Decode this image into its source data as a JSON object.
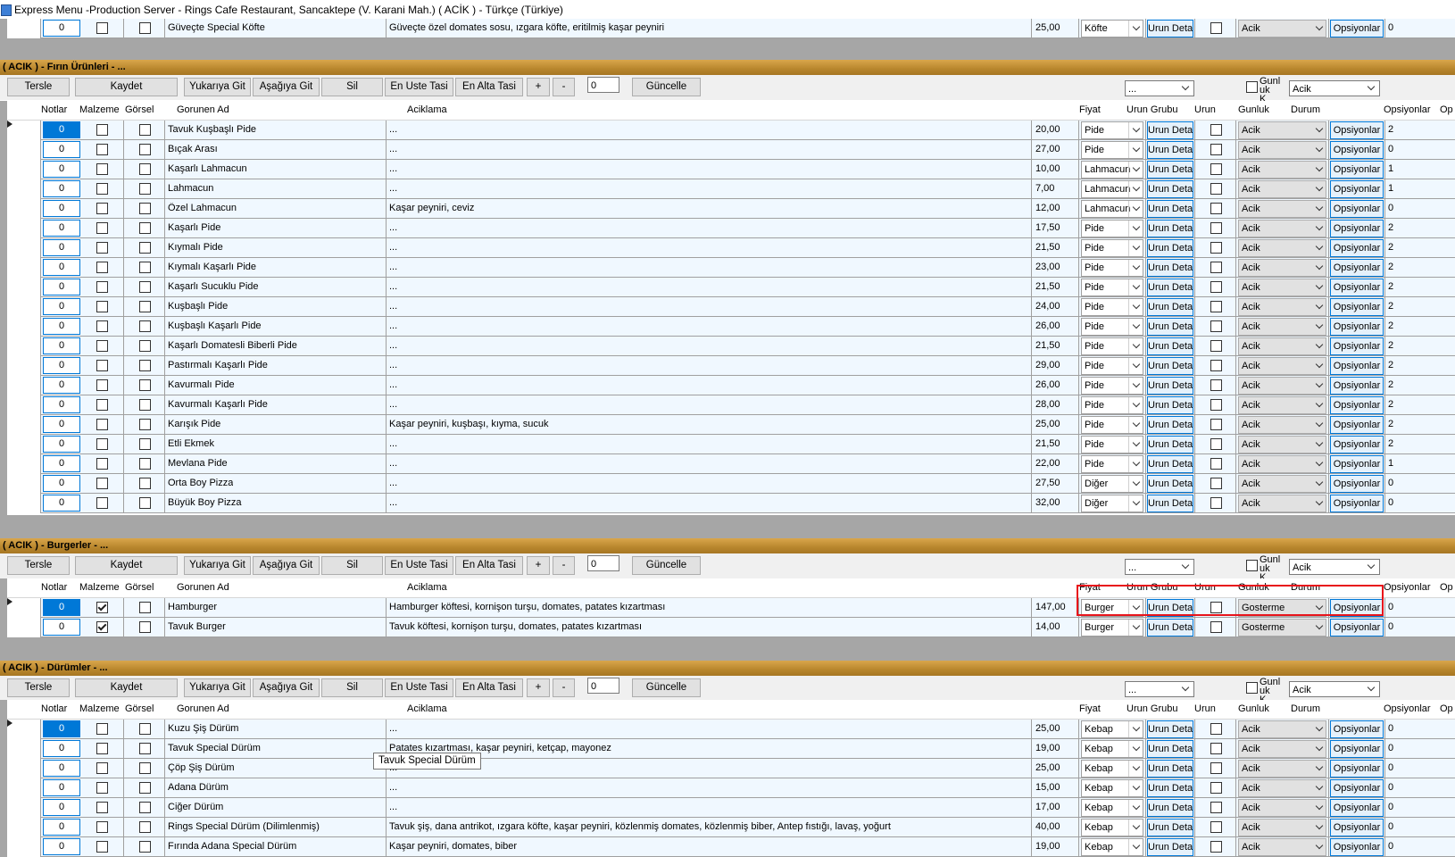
{
  "window": {
    "title": "Express Menu -Production Server - Rings Cafe Restaurant, Sancaktepe (V. Karani Mah.) ( ACİK ) - Türkçe (Türkiye)"
  },
  "columns": [
    "Notlar",
    "Malzeme",
    "Görsel",
    "Gorunen Ad",
    "Aciklama",
    "Fiyat",
    "Urun Grubu",
    "Urun",
    "Gunluk",
    "Durum",
    "Opsiyonlar",
    "Op"
  ],
  "toolbar": {
    "tersle": "Tersle",
    "kaydet": "Kaydet",
    "yukari": "Yukarıya Git",
    "asagi": "Aşağıya Git",
    "sil": "Sil",
    "en_uste": "En Uste Tasi",
    "en_alta": "En Alta Tasi",
    "plus": "+",
    "minus": "-",
    "order_value": "0",
    "guncelle": "Güncelle",
    "group_value": "...",
    "gunluk_label": "Gunl uk K",
    "durum_value": "Acik"
  },
  "common": {
    "detail_button": "Urun Detay",
    "options_button": "Opsiyonlar",
    "notes_value": "0"
  },
  "top_row": {
    "name": "Güveçte Special Köfte",
    "desc": "Güveçte özel domates sosu, ızgara köfte, eritilmiş kaşar peyniri",
    "price": "25,00",
    "group": "Köfte",
    "status": "Acik",
    "op": "0"
  },
  "sections": [
    {
      "title": "( ACIK ) - Fırın Ürünleri - ...",
      "rows": [
        {
          "name": "Tavuk Kuşbaşlı Pide",
          "desc": "...",
          "price": "20,00",
          "group": "Pide",
          "status": "Acik",
          "op": "2"
        },
        {
          "name": "Bıçak Arası",
          "desc": "...",
          "price": "27,00",
          "group": "Pide",
          "status": "Acik",
          "op": "0"
        },
        {
          "name": "Kaşarlı Lahmacun",
          "desc": "...",
          "price": "10,00",
          "group": "Lahmacun",
          "status": "Acik",
          "op": "1"
        },
        {
          "name": "Lahmacun",
          "desc": "...",
          "price": "7,00",
          "group": "Lahmacun",
          "status": "Acik",
          "op": "1"
        },
        {
          "name": "Özel Lahmacun",
          "desc": "Kaşar peyniri, ceviz",
          "price": "12,00",
          "group": "Lahmacun",
          "status": "Acik",
          "op": "0"
        },
        {
          "name": "Kaşarlı Pide",
          "desc": "...",
          "price": "17,50",
          "group": "Pide",
          "status": "Acik",
          "op": "2"
        },
        {
          "name": "Kıymalı Pide",
          "desc": "...",
          "price": "21,50",
          "group": "Pide",
          "status": "Acik",
          "op": "2"
        },
        {
          "name": "Kıymalı Kaşarlı Pide",
          "desc": "...",
          "price": "23,00",
          "group": "Pide",
          "status": "Acik",
          "op": "2"
        },
        {
          "name": "Kaşarlı Sucuklu Pide",
          "desc": "...",
          "price": "21,50",
          "group": "Pide",
          "status": "Acik",
          "op": "2"
        },
        {
          "name": "Kuşbaşlı Pide",
          "desc": "...",
          "price": "24,00",
          "group": "Pide",
          "status": "Acik",
          "op": "2"
        },
        {
          "name": "Kuşbaşlı Kaşarlı Pide",
          "desc": "...",
          "price": "26,00",
          "group": "Pide",
          "status": "Acik",
          "op": "2"
        },
        {
          "name": "Kaşarlı Domatesli Biberli Pide",
          "desc": "...",
          "price": "21,50",
          "group": "Pide",
          "status": "Acik",
          "op": "2"
        },
        {
          "name": "Pastırmalı Kaşarlı Pide",
          "desc": "...",
          "price": "29,00",
          "group": "Pide",
          "status": "Acik",
          "op": "2"
        },
        {
          "name": "Kavurmalı Pide",
          "desc": "...",
          "price": "26,00",
          "group": "Pide",
          "status": "Acik",
          "op": "2"
        },
        {
          "name": "Kavurmalı Kaşarlı Pide",
          "desc": "...",
          "price": "28,00",
          "group": "Pide",
          "status": "Acik",
          "op": "2"
        },
        {
          "name": "Karışık Pide",
          "desc": "Kaşar peyniri, kuşbaşı, kıyma, sucuk",
          "price": "25,00",
          "group": "Pide",
          "status": "Acik",
          "op": "2"
        },
        {
          "name": "Etli Ekmek",
          "desc": "...",
          "price": "21,50",
          "group": "Pide",
          "status": "Acik",
          "op": "2"
        },
        {
          "name": "Mevlana Pide",
          "desc": "...",
          "price": "22,00",
          "group": "Pide",
          "status": "Acik",
          "op": "1"
        },
        {
          "name": "Orta Boy Pizza",
          "desc": "...",
          "price": "27,50",
          "group": "Diğer",
          "status": "Acik",
          "op": "0"
        },
        {
          "name": "Büyük Boy Pizza",
          "desc": "...",
          "price": "32,00",
          "group": "Diğer",
          "status": "Acik",
          "op": "0"
        }
      ]
    },
    {
      "title": "( ACIK ) - Burgerler - ...",
      "rows": [
        {
          "name": "Hamburger",
          "desc": "Hamburger köftesi, kornişon turşu, domates, patates kızartması",
          "price": "147,00",
          "group": "Burger",
          "status": "Gosterme",
          "op": "0",
          "malzeme": true
        },
        {
          "name": "Tavuk Burger",
          "desc": "Tavuk köftesi, kornişon turşu, domates, patates kızartması",
          "price": "14,00",
          "group": "Burger",
          "status": "Gosterme",
          "op": "0",
          "malzeme": true
        }
      ]
    },
    {
      "title": "( ACIK ) - Dürümler - ...",
      "rows": [
        {
          "name": "Kuzu Şiş Dürüm",
          "desc": "...",
          "price": "25,00",
          "group": "Kebap",
          "status": "Acik",
          "op": "0"
        },
        {
          "name": "Tavuk Special Dürüm",
          "desc": "Patates kızartması, kaşar peyniri, ketçap, mayonez",
          "price": "19,00",
          "group": "Kebap",
          "status": "Acik",
          "op": "0"
        },
        {
          "name": "Çöp Şiş Dürüm",
          "desc": "...",
          "price": "25,00",
          "group": "Kebap",
          "status": "Acik",
          "op": "0"
        },
        {
          "name": "Adana Dürüm",
          "desc": "...",
          "price": "15,00",
          "group": "Kebap",
          "status": "Acik",
          "op": "0"
        },
        {
          "name": "Ciğer Dürüm",
          "desc": "...",
          "price": "17,00",
          "group": "Kebap",
          "status": "Acik",
          "op": "0"
        },
        {
          "name": "Rings Special Dürüm (Dilimlenmiş)",
          "desc": "Tavuk şiş, dana antrikot, ızgara köfte, kaşar peyniri, közlenmiş domates, közlenmiş biber, Antep fıstığı, lavaş, yoğurt",
          "price": "40,00",
          "group": "Kebap",
          "status": "Acik",
          "op": "0"
        },
        {
          "name": "Fırında Adana Special Dürüm",
          "desc": "Kaşar peyniri, domates, biber",
          "price": "19,00",
          "group": "Kebap",
          "status": "Acik",
          "op": "0"
        }
      ]
    }
  ],
  "tooltip": "Tavuk Special Dürüm",
  "colors": {
    "section_gold": "#c8953a",
    "selection_blue": "#0078d7",
    "highlight_red": "#e8141b"
  }
}
